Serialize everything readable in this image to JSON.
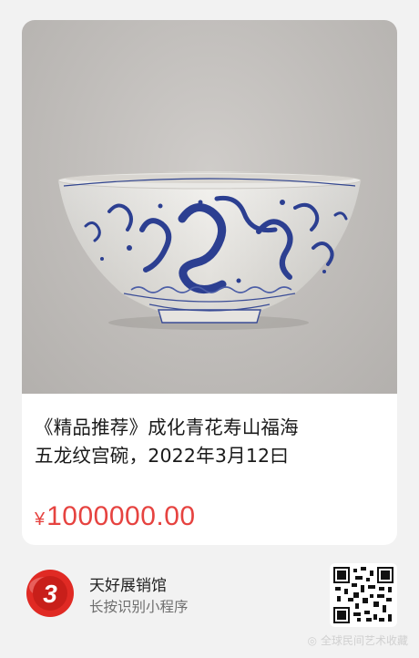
{
  "product": {
    "title_line1": "《精品推荐》成化青花寿山福海",
    "title_line2": "五龙纹宫碗，2022年3月12曰",
    "currency": "¥",
    "price": "1000000.00"
  },
  "shop": {
    "name": "天好展销馆",
    "hint": "长按识别小程序",
    "logo_icon": "red-circle-3-logo"
  },
  "watermark": {
    "text": "全球民间艺术收藏"
  },
  "colors": {
    "price": "#e64340",
    "logo_red": "#e02a24",
    "porcelain_blue": "#2c3f91"
  }
}
